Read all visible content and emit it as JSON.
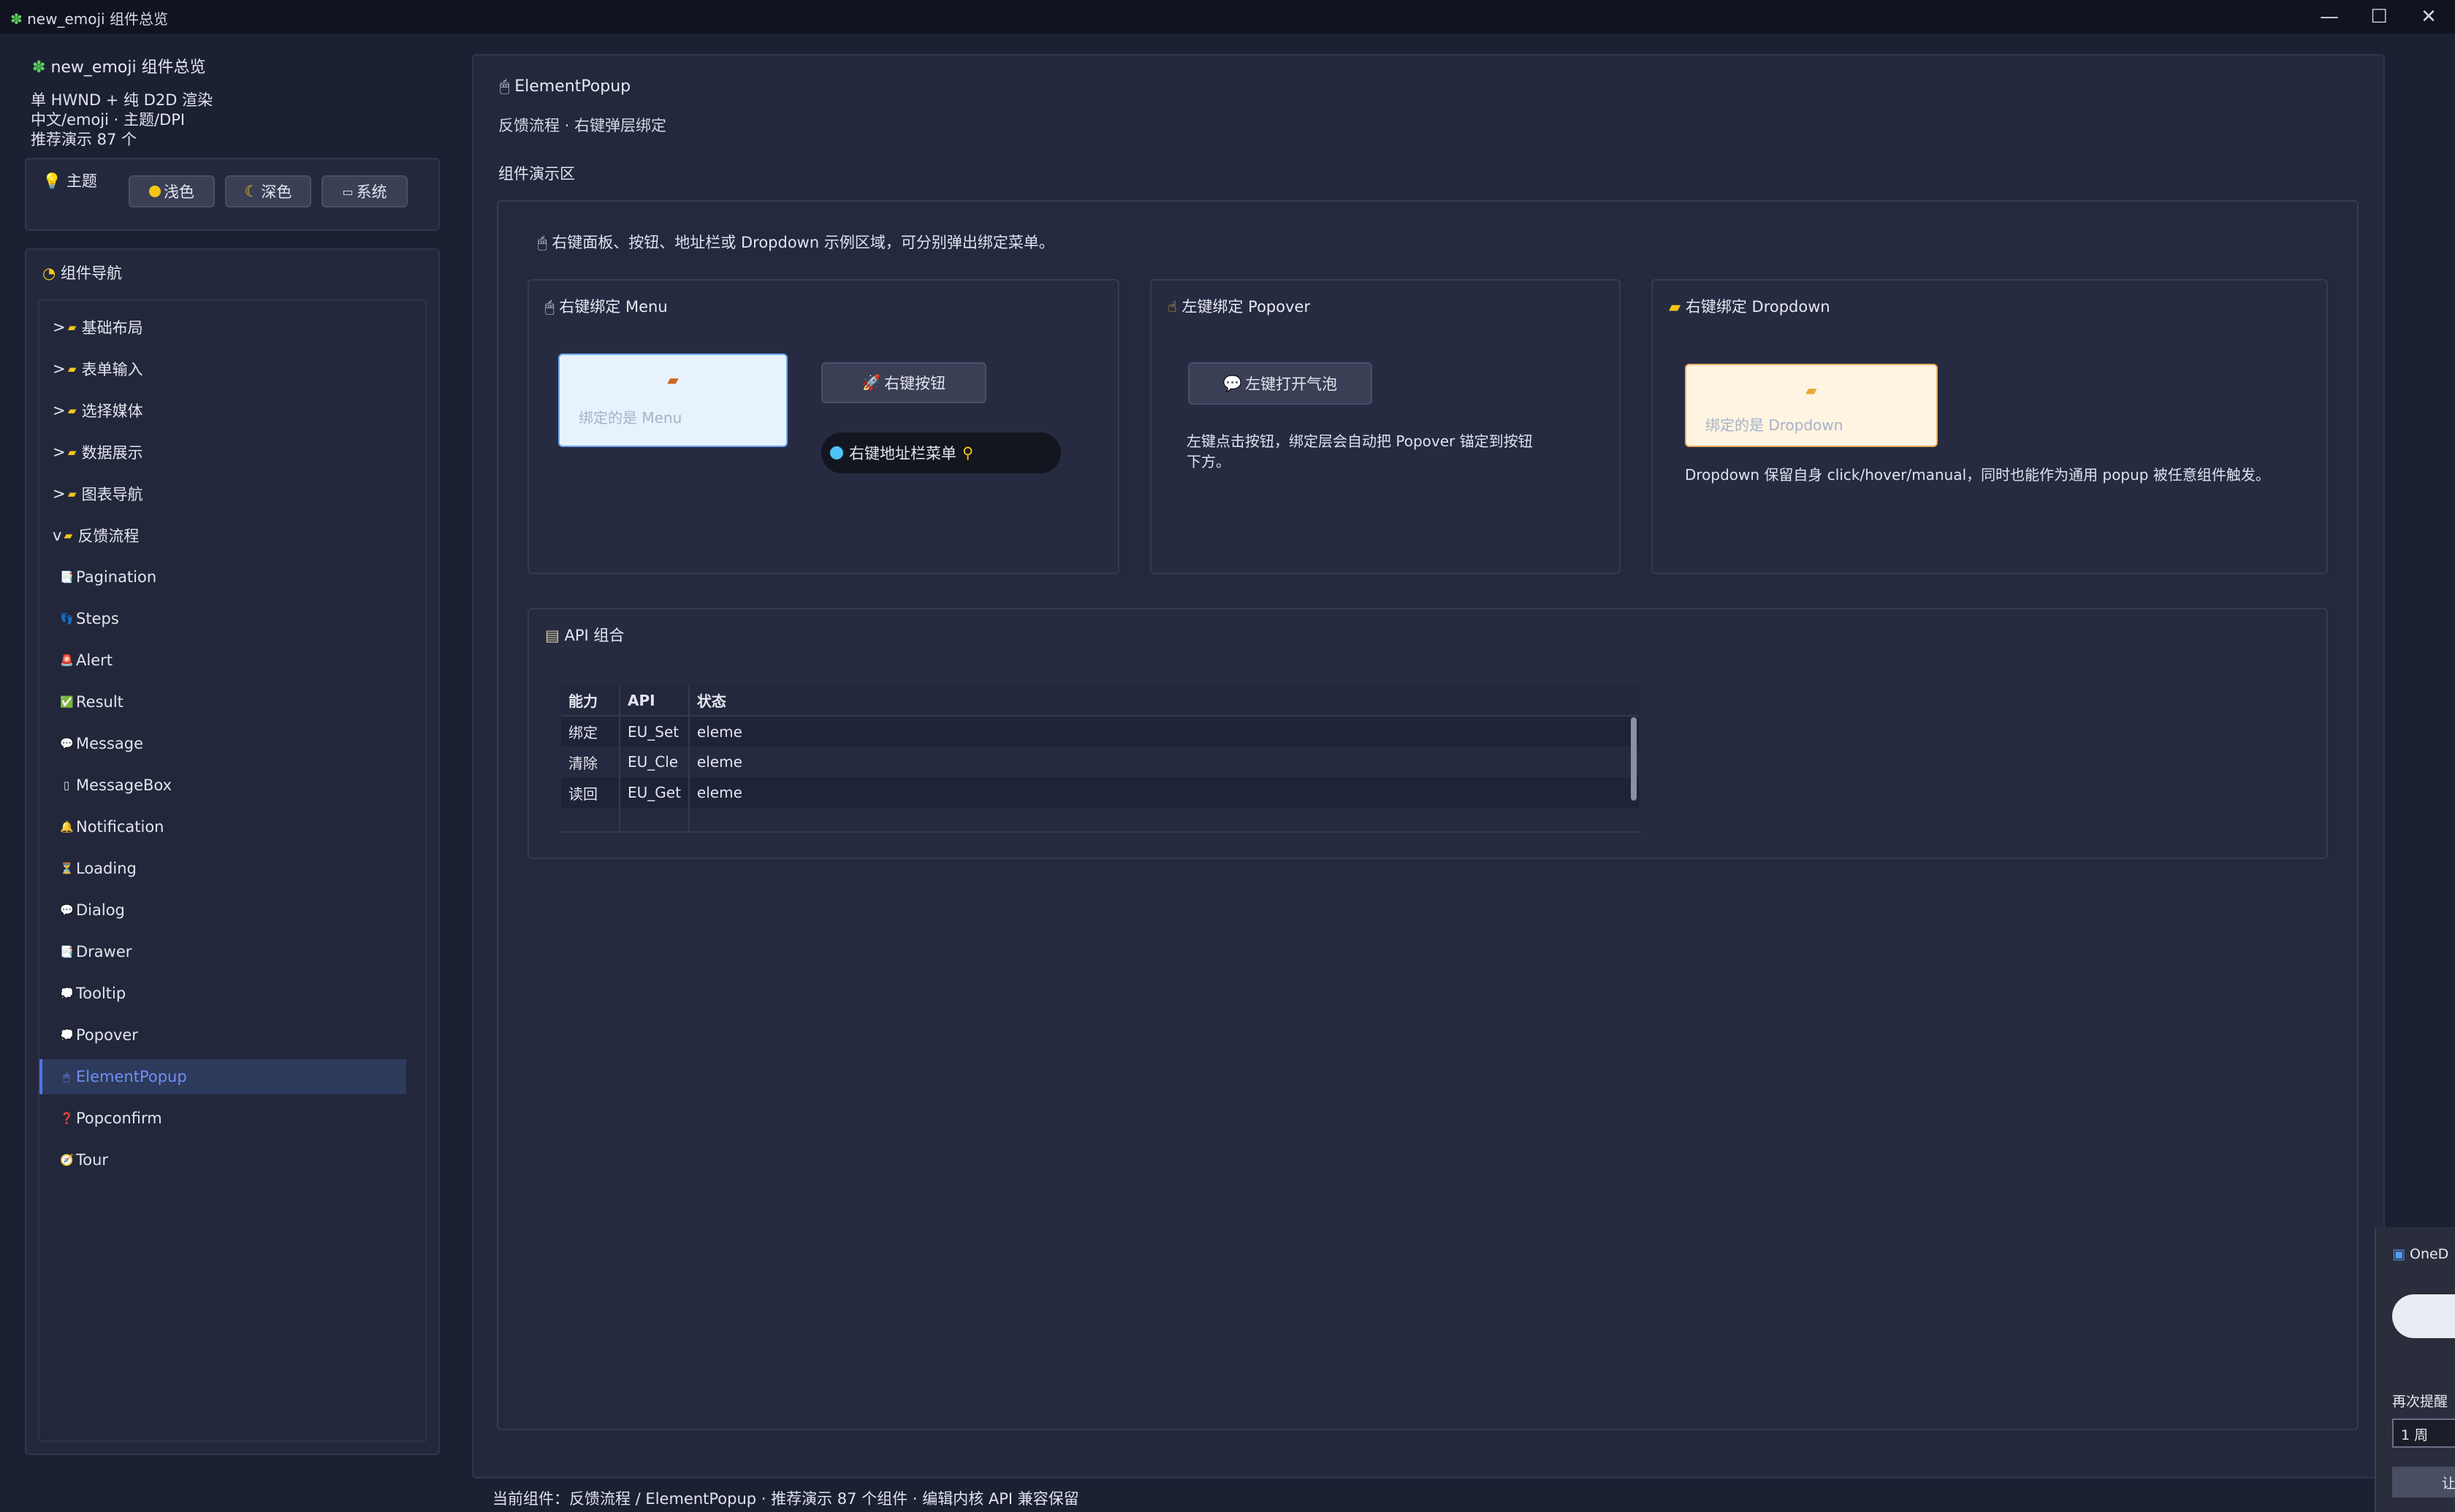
{
  "window": {
    "title": "new_emoji 组件总览",
    "controls": [
      "—",
      "☐",
      "✕"
    ]
  },
  "app": {
    "name": "new_emoji 组件总览",
    "info": [
      "单 HWND + 纯 D2D 渲染",
      "中文/emoji · 主题/DPI",
      "推荐演示 87 个"
    ]
  },
  "theme": {
    "label": "主题",
    "buttons": [
      {
        "label": "浅色",
        "icon": "sun-icon"
      },
      {
        "label": "深色",
        "icon": "moon-icon"
      },
      {
        "label": "系统",
        "icon": "laptop-icon"
      }
    ]
  },
  "nav": {
    "title": "组件导航",
    "items": [
      {
        "label": "基础布局",
        "prefix": ">",
        "type": "group"
      },
      {
        "label": "表单输入",
        "prefix": ">",
        "type": "group"
      },
      {
        "label": "选择媒体",
        "prefix": ">",
        "type": "group"
      },
      {
        "label": "数据展示",
        "prefix": ">",
        "type": "group"
      },
      {
        "label": "图表导航",
        "prefix": ">",
        "type": "group"
      },
      {
        "label": "反馈流程",
        "prefix": "v",
        "type": "group"
      },
      {
        "label": "Pagination",
        "icon": "📑"
      },
      {
        "label": "Steps",
        "icon": "👣"
      },
      {
        "label": "Alert",
        "icon": "🚨"
      },
      {
        "label": "Result",
        "icon": "✅"
      },
      {
        "label": "Message",
        "icon": "💬"
      },
      {
        "label": "MessageBox",
        "icon": "▯"
      },
      {
        "label": "Notification",
        "icon": "🔔"
      },
      {
        "label": "Loading",
        "icon": "⏳"
      },
      {
        "label": "Dialog",
        "icon": "💬"
      },
      {
        "label": "Drawer",
        "icon": "📑"
      },
      {
        "label": "Tooltip",
        "icon": "💭"
      },
      {
        "label": "Popover",
        "icon": "💭"
      },
      {
        "label": "ElementPopup",
        "icon": "🖱",
        "active": true
      },
      {
        "label": "Popconfirm",
        "icon": "❓"
      },
      {
        "label": "Tour",
        "icon": "🧭"
      }
    ]
  },
  "page": {
    "title": "ElementPopup",
    "subtitle": "反馈流程 · 右键弹层绑定",
    "demo_label": "组件演示区",
    "hint": "右键面板、按钮、地址栏或 Dropdown 示例区域，可分别弹出绑定菜单。"
  },
  "cards": {
    "menu": {
      "title": "右键绑定 Menu",
      "box_text": "绑定的是 Menu",
      "button": "右键按钮",
      "address": "右键地址栏菜单"
    },
    "popover": {
      "title": "左键绑定 Popover",
      "button": "左键打开气泡",
      "desc_lines": [
        "左键点击按钮，绑定层会自动把 Popover 锚定到按钮",
        "下方。"
      ]
    },
    "dropdown": {
      "title": "右键绑定 Dropdown",
      "box_text": "绑定的是 Dropdown",
      "desc": "Dropdown 保留自身 click/hover/manual，同时也能作为通用 popup 被任意组件触发。"
    }
  },
  "api": {
    "title": "API 组合",
    "headers": [
      "能力",
      "API",
      "状态"
    ],
    "rows": [
      [
        "绑定",
        "EU_Set",
        "eleme"
      ],
      [
        "清除",
        "EU_Cle",
        "eleme"
      ],
      [
        "读回",
        "EU_Get",
        "eleme"
      ]
    ]
  },
  "status_bar": "当前组件：反馈流程 / ElementPopup · 推荐演示 87 个组件 · 编辑内核 API 兼容保留",
  "toast": {
    "app": "OneD",
    "remind": "再次提醒",
    "select": "1 周",
    "button": "让"
  }
}
